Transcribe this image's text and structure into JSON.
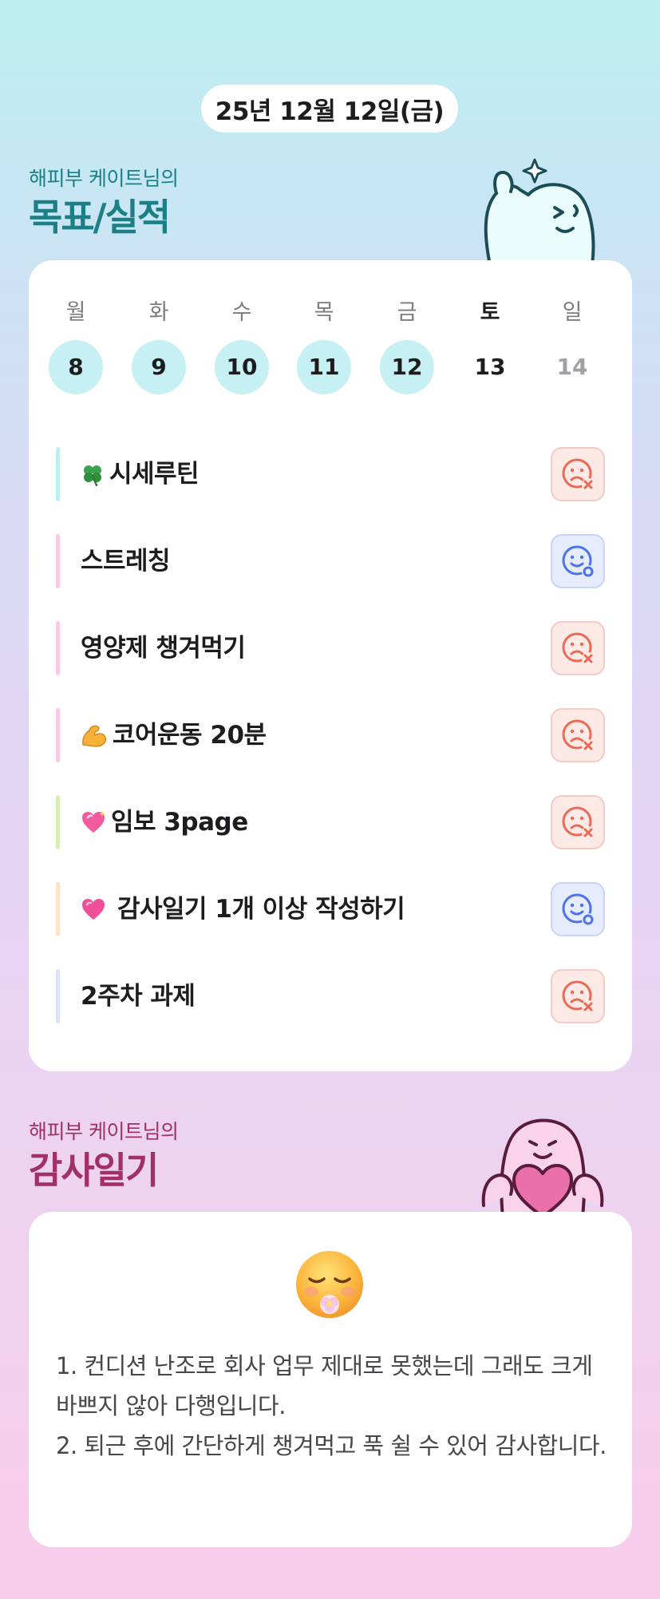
{
  "header": {
    "date": "25년 12월 12일(금)"
  },
  "goals_section": {
    "subtitle": "해피부 케이트님의",
    "title": "목표/실적"
  },
  "week": {
    "days": [
      {
        "name": "월",
        "num": "8",
        "state": "done"
      },
      {
        "name": "화",
        "num": "9",
        "state": "done"
      },
      {
        "name": "수",
        "num": "10",
        "state": "done"
      },
      {
        "name": "목",
        "num": "11",
        "state": "done"
      },
      {
        "name": "금",
        "num": "12",
        "state": "done"
      },
      {
        "name": "토",
        "num": "13",
        "state": "today"
      },
      {
        "name": "일",
        "num": "14",
        "state": "future"
      }
    ]
  },
  "goals": [
    {
      "icon": "clover-icon",
      "label": "시세루틴",
      "color": "#bdeef2",
      "status": "fail"
    },
    {
      "icon": "",
      "label": "스트레칭",
      "color": "#f9c9e6",
      "status": "success"
    },
    {
      "icon": "",
      "label": "영양제 챙겨먹기",
      "color": "#f9c9e6",
      "status": "fail"
    },
    {
      "icon": "flexed-biceps-icon",
      "label": "코어운동 20분",
      "color": "#f9c9e6",
      "status": "fail"
    },
    {
      "icon": "sparkling-heart-icon",
      "label": "임보 3page",
      "color": "#d6f0b3",
      "status": "fail"
    },
    {
      "icon": "pink-heart-icon",
      "label": "감사일기 1개 이상 작성하기",
      "color": "#fde2c4",
      "status": "success"
    },
    {
      "icon": "",
      "label": "2주차 과제",
      "color": "#d8e2f9",
      "status": "fail"
    }
  ],
  "diary_section": {
    "subtitle": "해피부 케이트님의",
    "title": "감사일기"
  },
  "diary": {
    "emoji": "relieved-face-with-flower-icon",
    "lines": [
      "1. 컨디션 난조로 회사 업무 제대로 못했는데 그래도 크게 바쁘지 않아 다행입니다.",
      "2. 퇴근 후에 간단하게 챙겨먹고 푹 쉴 수 있어 감사합니다."
    ]
  },
  "colors": {
    "teal_title": "#1b7f85",
    "berry_title": "#a03067",
    "done_circle": "#c6f0f3",
    "fail_red": "#ea6a55",
    "success_blue": "#4a74e8"
  }
}
